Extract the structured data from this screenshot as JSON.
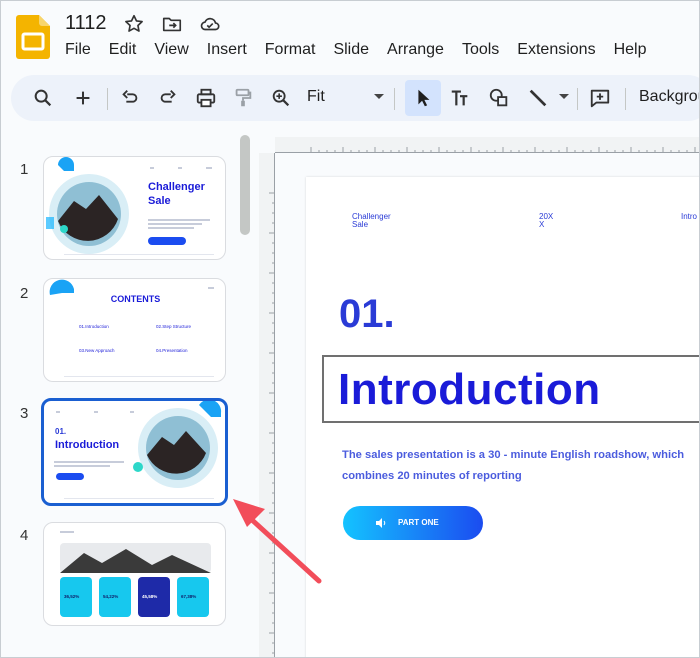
{
  "app": {
    "doc_title": "1112",
    "menu": [
      "File",
      "Edit",
      "View",
      "Insert",
      "Format",
      "Slide",
      "Arrange",
      "Tools",
      "Extensions",
      "Help"
    ]
  },
  "toolbar": {
    "zoom_value": "Fit",
    "background_label": "Background",
    "icons": [
      "search-icon",
      "add-icon",
      "undo-icon",
      "redo-icon",
      "print-icon",
      "paint-format-icon",
      "zoom-icon",
      "select-icon",
      "text-box-icon",
      "shape-icon",
      "line-icon",
      "comment-icon"
    ]
  },
  "filmstrip": {
    "slides": [
      {
        "number": "1",
        "title": "Challenger Sale"
      },
      {
        "number": "2",
        "title": "CONTENTS",
        "items": [
          "01.Introduction",
          "02.Step Structure",
          "03.New Approach",
          "04.Presentation"
        ]
      },
      {
        "number": "3",
        "title": "Introduction",
        "label": "01.",
        "selected": true
      },
      {
        "number": "4",
        "stats": [
          "36,52%",
          "54,22%",
          "45,58%",
          "67,38%"
        ]
      }
    ]
  },
  "slide": {
    "header_left": "Challenger\nSale",
    "header_mid": "20X\nX",
    "header_right": "Intro",
    "number": "01.",
    "title": "Introduction",
    "body_line1": "The sales presentation is a 30 - minute English roadshow, which",
    "body_line2": "combines 20 minutes of reporting",
    "button_label": "PART ONE"
  },
  "colors": {
    "accent_blue": "#1a1bd8",
    "link_blue": "#4b5cde",
    "selection": "#1a5fd1",
    "arrow_red": "#f24d5a"
  }
}
